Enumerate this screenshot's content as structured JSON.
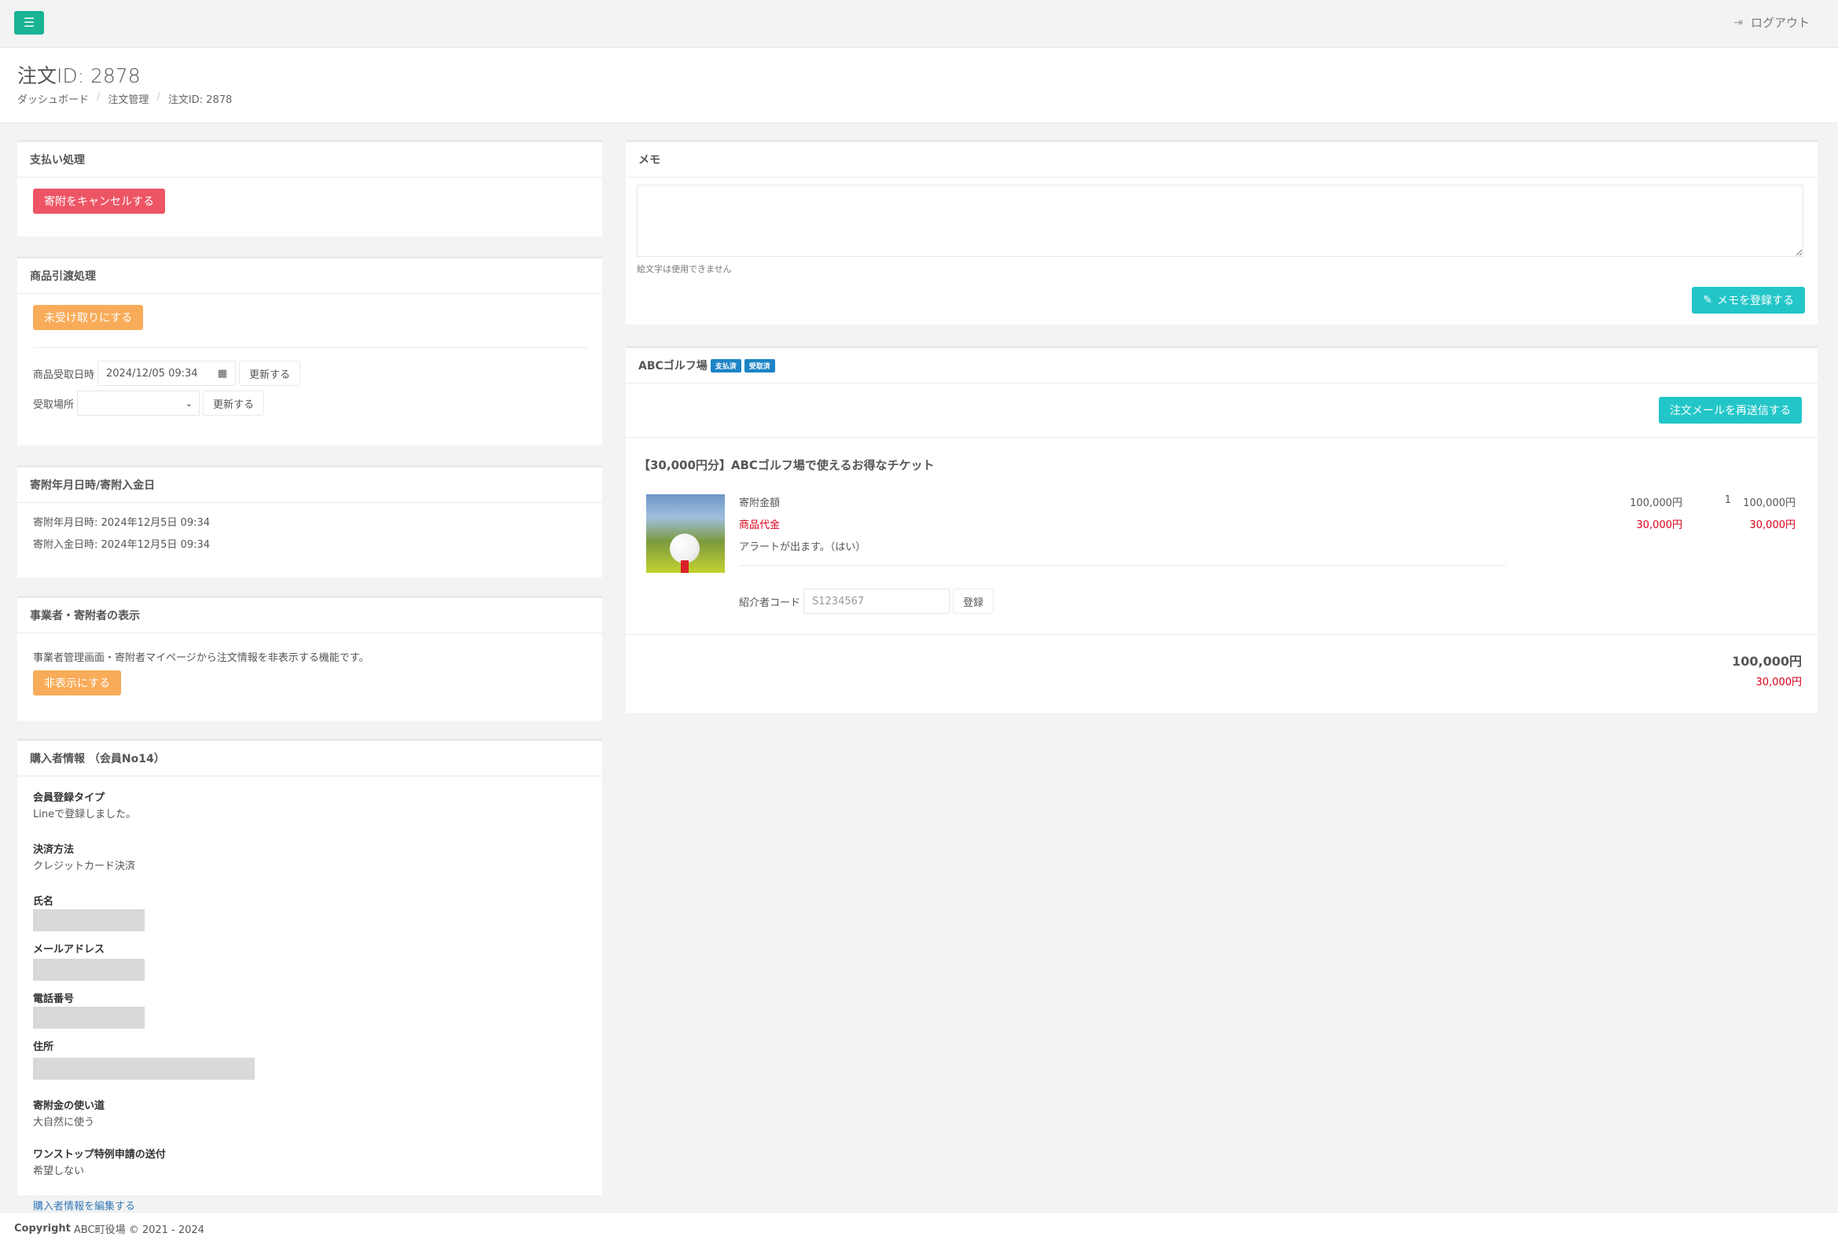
{
  "topbar": {
    "menu_icon": "hamburger-icon",
    "logout_icon": "sign-out-icon",
    "logout_label": "ログアウト"
  },
  "header": {
    "title": "注文ID: 2878",
    "breadcrumb": [
      "ダッシュボード",
      "注文管理",
      "注文ID: 2878"
    ]
  },
  "payment": {
    "title": "支払い処理",
    "cancel_label": "寄附をキャンセルする"
  },
  "delivery": {
    "title": "商品引渡処理",
    "unreceived_label": "未受け取りにする",
    "received_date_label": "商品受取日時",
    "received_date_value": "2024/12/05 09:34",
    "update_label": "更新する",
    "place_label": "受取場所",
    "place_value": "",
    "update_label_2": "更新する"
  },
  "donation_dates": {
    "title": "寄附年月日時/寄附入金日",
    "donation_date": "寄附年月日時: 2024年12月5日 09:34",
    "deposit_date": "寄附入金日時: 2024年12月5日 09:34"
  },
  "visibility": {
    "title": "事業者・寄附者の表示",
    "description": "事業者管理画面・寄附者マイページから注文情報を非表示する機能です。",
    "hide_label": "非表示にする"
  },
  "buyer": {
    "title": "購入者情報 （会員No14）",
    "fields": [
      {
        "label": "会員登録タイプ",
        "value": "Lineで登録しました。"
      },
      {
        "label": "決済方法",
        "value": "クレジットカード決済"
      },
      {
        "label": "氏名",
        "value": ""
      },
      {
        "label": "メールアドレス",
        "value": ""
      },
      {
        "label": "電話番号",
        "value": ""
      },
      {
        "label": "住所",
        "value": ""
      },
      {
        "label": "寄附金の使い道",
        "value": "大自然に使う"
      },
      {
        "label": "ワンストップ特例申請の送付",
        "value": "希望しない"
      }
    ],
    "edit_link": "購入者情報を編集する"
  },
  "memo": {
    "title": "メモ",
    "value": "",
    "help": "絵文字は使用できません",
    "save_label": "メモを登録する",
    "save_icon": "pencil-icon"
  },
  "order": {
    "shop_name": "ABCゴルフ場",
    "badges": [
      "支払済",
      "受取済"
    ],
    "resend_label": "注文メールを再送信する",
    "product_title": "【30,000円分】ABCゴルフ場で使えるお得なチケット",
    "donation_label": "寄附金額",
    "donation_unit": "100,000円",
    "quantity": "1",
    "donation_total": "100,000円",
    "product_cost_label": "商品代金",
    "product_cost_unit": "30,000円",
    "product_cost_total": "30,000円",
    "alert_text": "アラートが出ます。（はい）",
    "referrer_label": "紹介者コード",
    "referrer_placeholder": "S1234567",
    "register_label": "登録",
    "grand_total": "100,000円",
    "grand_cost": "30,000円"
  },
  "footer": {
    "copyright_bold": "Copyright",
    "copyright_text": "ABC町役場 © 2021 - 2024"
  },
  "colors": {
    "primary": "#1ab394",
    "danger": "#ed5565",
    "warning": "#f8ac59",
    "info": "#23c6c8",
    "badge": "#1c84c6"
  }
}
